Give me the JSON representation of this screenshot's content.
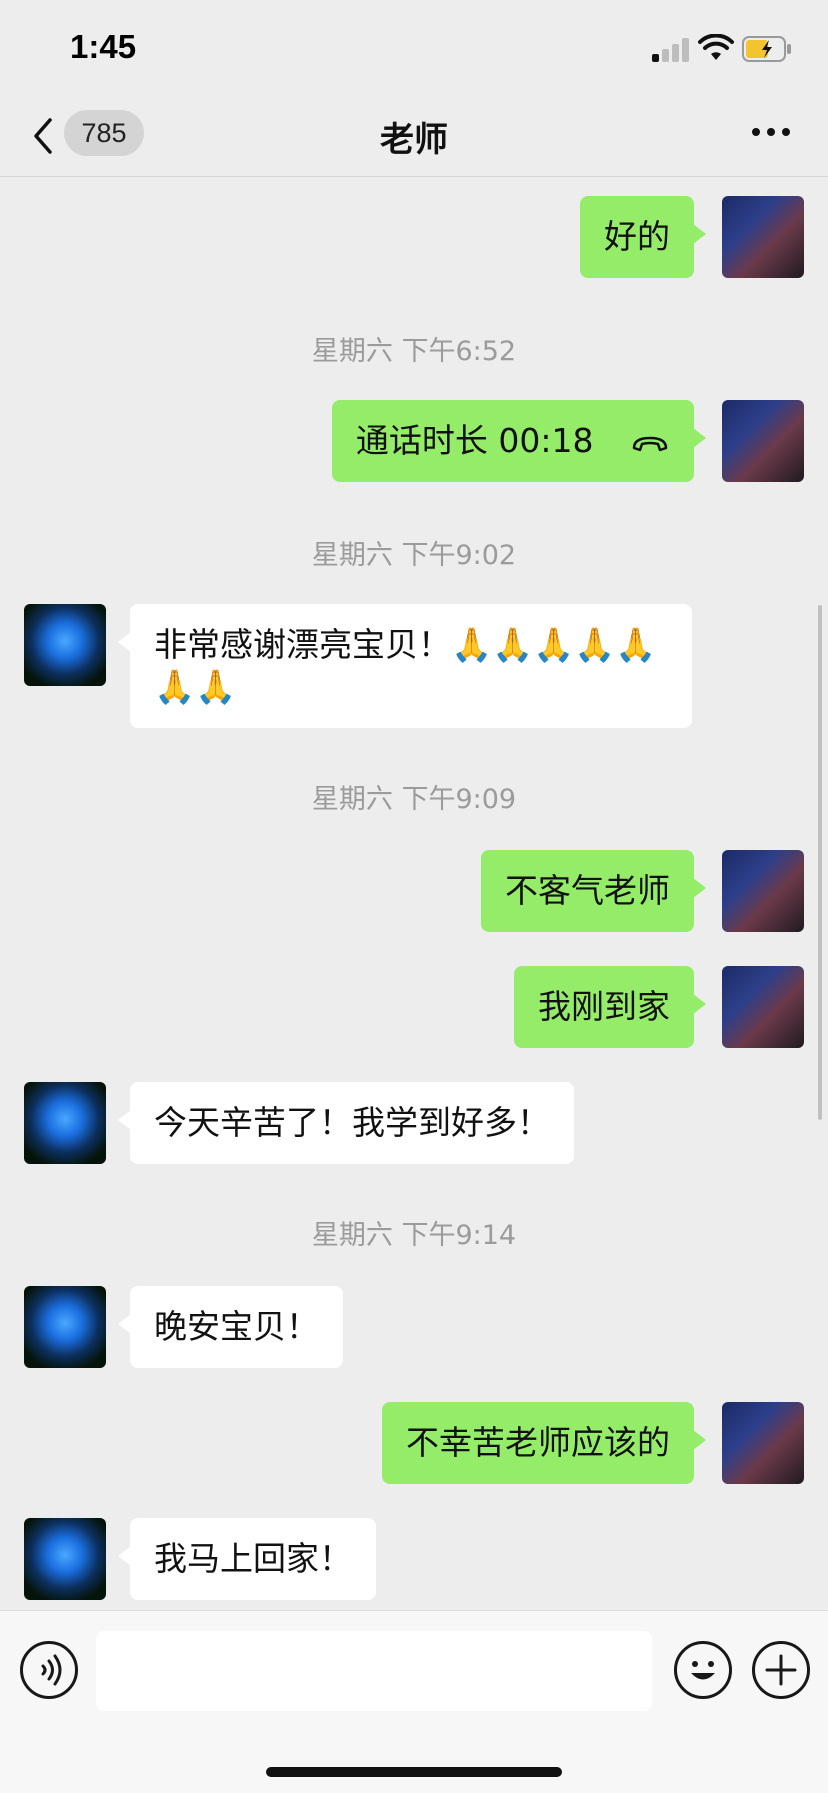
{
  "status_bar": {
    "time": "1:45"
  },
  "nav": {
    "unread_count": "785",
    "title": "老师"
  },
  "colors": {
    "my_bubble": "#95ec69",
    "their_bubble": "#ffffff",
    "background": "#ededed",
    "timestamp": "#9b9b9b"
  },
  "messages": {
    "m1": {
      "sender": "me",
      "text": "好的"
    },
    "ts1": "星期六 下午6:52",
    "m2": {
      "sender": "me",
      "text": "通话时长 00:18",
      "icon": "hangup-icon"
    },
    "ts2": "星期六 下午9:02",
    "m3": {
      "sender": "other",
      "text_line1": "非常感谢漂亮宝贝！🙏🙏🙏🙏🙏",
      "text_line2": "🙏🙏"
    },
    "ts3": "星期六 下午9:09",
    "m4": {
      "sender": "me",
      "text": "不客气老师"
    },
    "m5": {
      "sender": "me",
      "text": "我刚到家"
    },
    "m6": {
      "sender": "other",
      "text": "今天辛苦了！我学到好多！"
    },
    "ts4": "星期六 下午9:14",
    "m7": {
      "sender": "other",
      "text": "晚安宝贝！"
    },
    "m8": {
      "sender": "me",
      "text": "不幸苦老师应该的"
    },
    "m9": {
      "sender": "other",
      "text": "我马上回家！"
    }
  },
  "input_bar": {
    "value": "",
    "icons": [
      "voice-icon",
      "emoji-icon",
      "plus-icon"
    ]
  }
}
